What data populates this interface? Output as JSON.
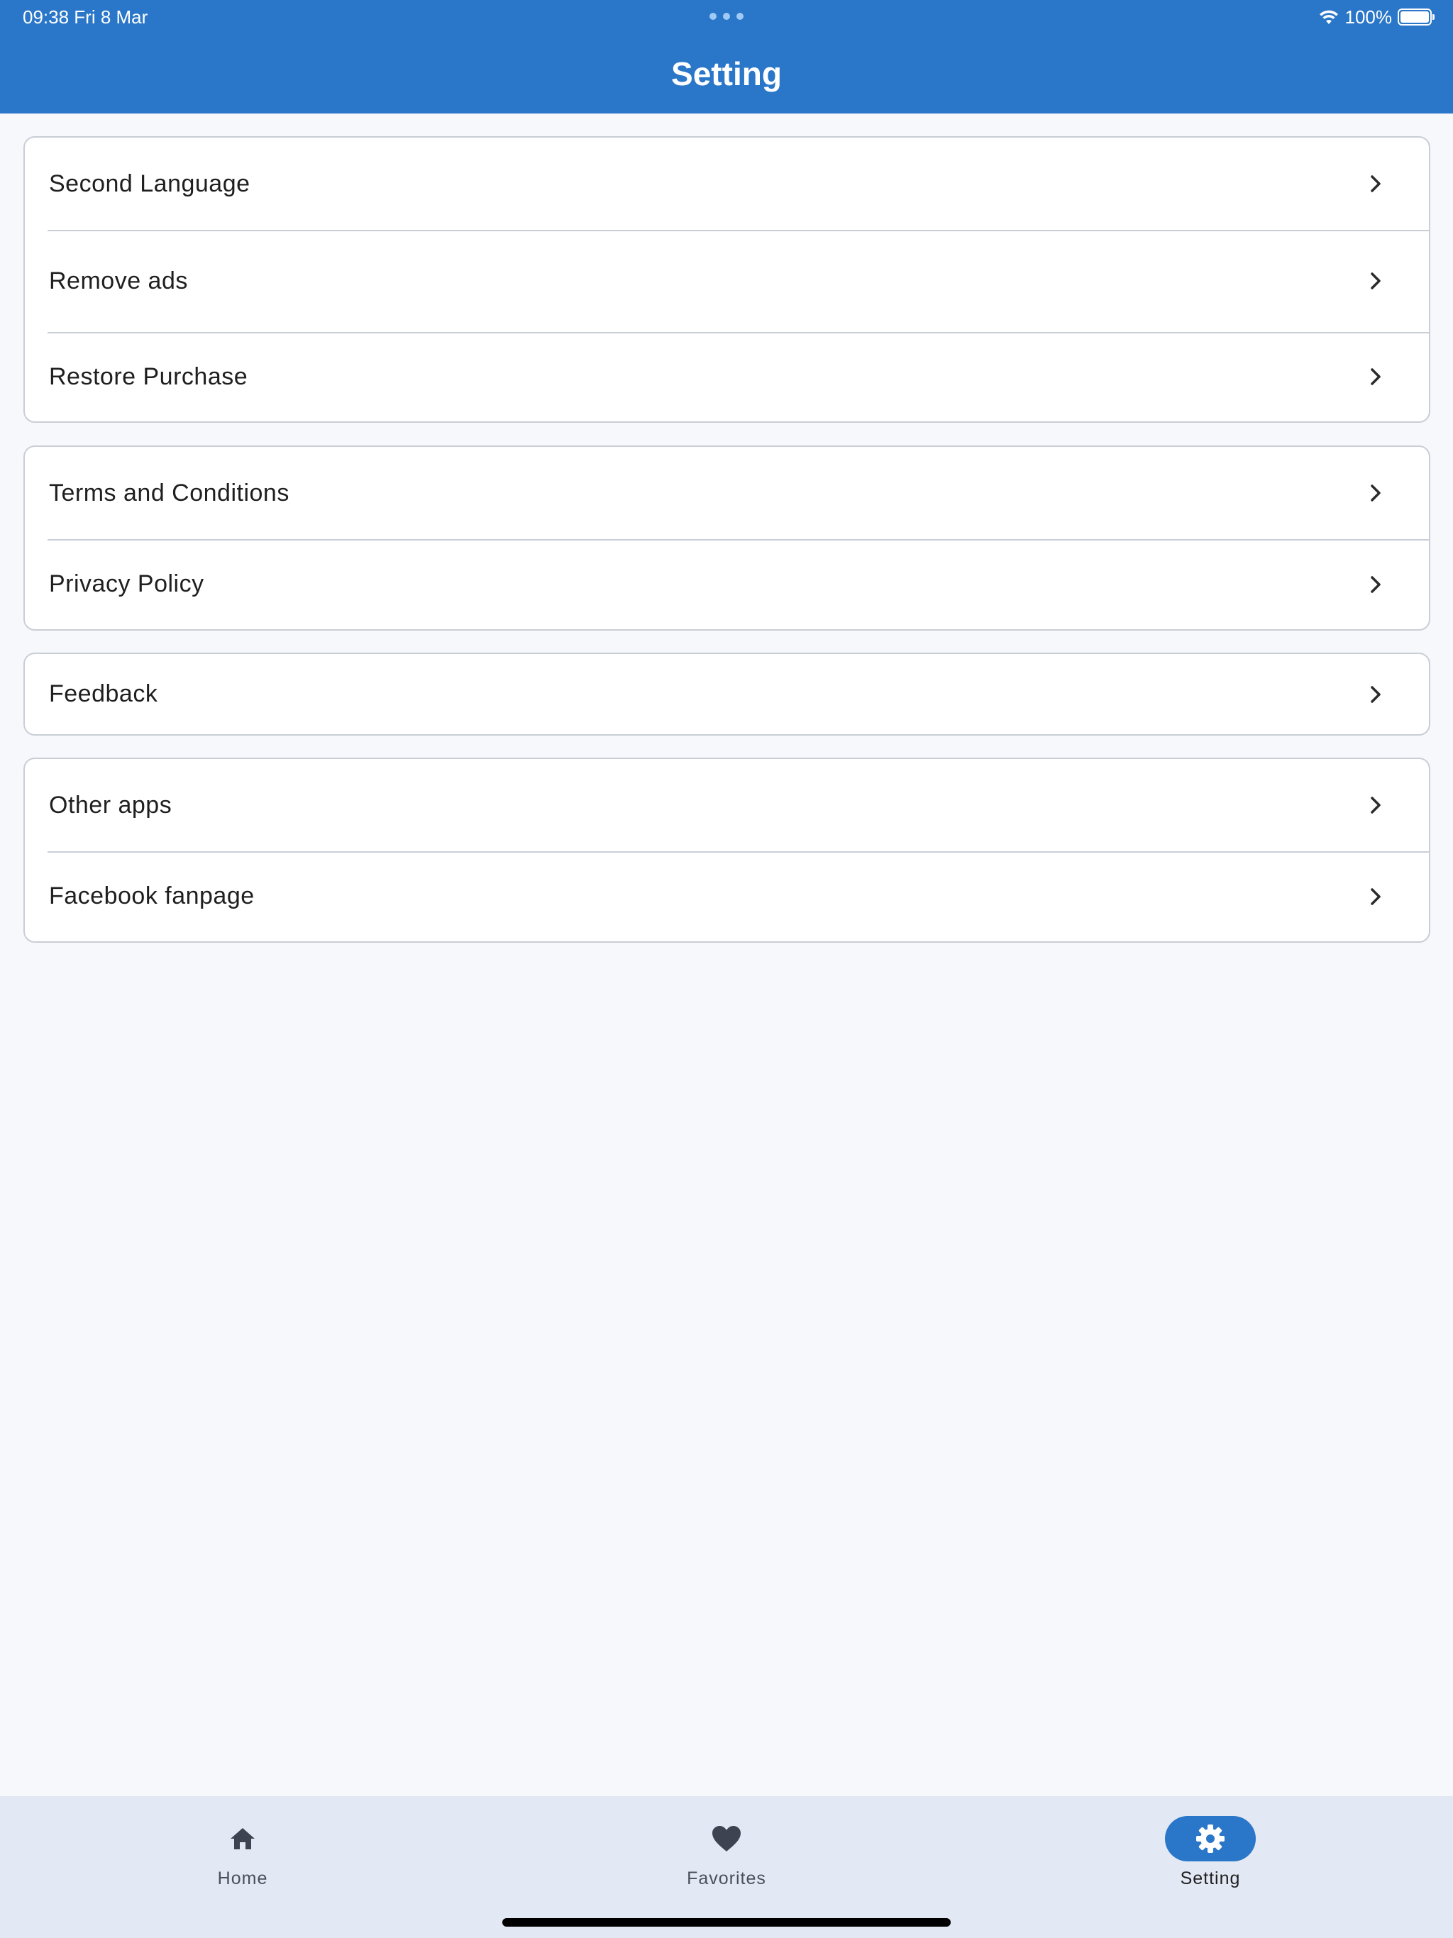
{
  "status_bar": {
    "time": "09:38   Fri 8 Mar",
    "battery": "100%",
    "battery_level": 1.0
  },
  "header": {
    "title": "Setting"
  },
  "groups": [
    {
      "items": [
        {
          "label": "Second Language",
          "icon": "chevron-right-icon"
        },
        {
          "label": "Remove ads",
          "icon": "chevron-right-icon"
        },
        {
          "label": "Restore Purchase",
          "icon": "chevron-right-icon"
        }
      ]
    },
    {
      "items": [
        {
          "label": "Terms and Conditions",
          "icon": "chevron-right-icon"
        },
        {
          "label": "Privacy Policy",
          "icon": "chevron-right-icon"
        }
      ]
    },
    {
      "items": [
        {
          "label": "Feedback",
          "icon": "chevron-right-icon"
        }
      ]
    },
    {
      "items": [
        {
          "label": "Other apps",
          "icon": "chevron-right-icon"
        },
        {
          "label": "Facebook fanpage",
          "icon": "chevron-right-icon"
        }
      ]
    }
  ],
  "bottom_nav": {
    "items": [
      {
        "label": "Home",
        "icon": "home-icon",
        "active": false
      },
      {
        "label": "Favorites",
        "icon": "heart-icon",
        "active": false
      },
      {
        "label": "Setting",
        "icon": "gear-icon",
        "active": true
      }
    ]
  },
  "colors": {
    "primary": "#2a76c8",
    "background": "#f6f8fc",
    "nav_background": "#e3e9f4",
    "border": "#c9ced6"
  }
}
